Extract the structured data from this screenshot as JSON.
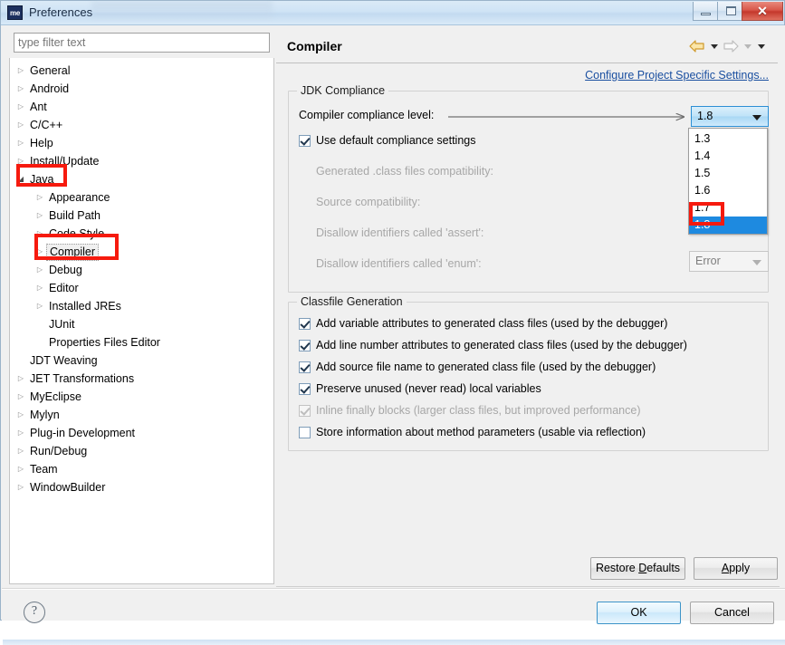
{
  "window": {
    "title": "Preferences",
    "app_icon_text": "me",
    "controls": {
      "minimize": "minimize-button",
      "maximize": "maximize-button",
      "close_glyph": "✕"
    }
  },
  "filter": {
    "value": "",
    "placeholder": "type filter text"
  },
  "tree": {
    "items": [
      {
        "label": "General",
        "indent": 0,
        "twisty": "collapsed",
        "selected": false
      },
      {
        "label": "Android",
        "indent": 0,
        "twisty": "collapsed",
        "selected": false
      },
      {
        "label": "Ant",
        "indent": 0,
        "twisty": "collapsed",
        "selected": false
      },
      {
        "label": "C/C++",
        "indent": 0,
        "twisty": "collapsed",
        "selected": false
      },
      {
        "label": "Help",
        "indent": 0,
        "twisty": "collapsed",
        "selected": false
      },
      {
        "label": "Install/Update",
        "indent": 0,
        "twisty": "collapsed",
        "selected": false
      },
      {
        "label": "Java",
        "indent": 0,
        "twisty": "expanded",
        "selected": false
      },
      {
        "label": "Appearance",
        "indent": 1,
        "twisty": "collapsed",
        "selected": false
      },
      {
        "label": "Build Path",
        "indent": 1,
        "twisty": "collapsed",
        "selected": false
      },
      {
        "label": "Code Style",
        "indent": 1,
        "twisty": "collapsed",
        "selected": false
      },
      {
        "label": "Compiler",
        "indent": 1,
        "twisty": "collapsed",
        "selected": true
      },
      {
        "label": "Debug",
        "indent": 1,
        "twisty": "collapsed",
        "selected": false
      },
      {
        "label": "Editor",
        "indent": 1,
        "twisty": "collapsed",
        "selected": false
      },
      {
        "label": "Installed JREs",
        "indent": 1,
        "twisty": "collapsed",
        "selected": false
      },
      {
        "label": "JUnit",
        "indent": 1,
        "twisty": "none",
        "selected": false
      },
      {
        "label": "Properties Files Editor",
        "indent": 1,
        "twisty": "none",
        "selected": false
      },
      {
        "label": "JDT Weaving",
        "indent": 0,
        "twisty": "none",
        "selected": false
      },
      {
        "label": "JET Transformations",
        "indent": 0,
        "twisty": "collapsed",
        "selected": false
      },
      {
        "label": "MyEclipse",
        "indent": 0,
        "twisty": "collapsed",
        "selected": false
      },
      {
        "label": "Mylyn",
        "indent": 0,
        "twisty": "collapsed",
        "selected": false
      },
      {
        "label": "Plug-in Development",
        "indent": 0,
        "twisty": "collapsed",
        "selected": false
      },
      {
        "label": "Run/Debug",
        "indent": 0,
        "twisty": "collapsed",
        "selected": false
      },
      {
        "label": "Team",
        "indent": 0,
        "twisty": "collapsed",
        "selected": false
      },
      {
        "label": "WindowBuilder",
        "indent": 0,
        "twisty": "collapsed",
        "selected": false
      }
    ]
  },
  "page": {
    "title": "Compiler",
    "configure_link": "Configure Project Specific Settings...",
    "nav": {
      "back_icon": "back-arrow-icon",
      "forward_icon": "forward-arrow-icon",
      "menu_icon": "view-menu-icon"
    }
  },
  "jdk_compliance": {
    "legend": "JDK Compliance",
    "compliance_level_label": "Compiler compliance level:",
    "compliance_level_value": "1.8",
    "use_default": {
      "label": "Use default compliance settings",
      "checked": true,
      "enabled": true
    },
    "rows": [
      {
        "label": "Generated .class files compatibility:",
        "enabled": false
      },
      {
        "label": "Source compatibility:",
        "enabled": false
      },
      {
        "label": "Disallow identifiers called 'assert':",
        "enabled": false
      },
      {
        "label": "Disallow identifiers called 'enum':",
        "enabled": false
      }
    ],
    "enum_combo_value": "Error",
    "dropdown": {
      "open": true,
      "options": [
        "1.3",
        "1.4",
        "1.5",
        "1.6",
        "1.7",
        "1.8"
      ],
      "selected": "1.8"
    }
  },
  "classfile_generation": {
    "legend": "Classfile Generation",
    "options": [
      {
        "label": "Add variable attributes to generated class files (used by the debugger)",
        "checked": true,
        "enabled": true
      },
      {
        "label": "Add line number attributes to generated class files (used by the debugger)",
        "checked": true,
        "enabled": true
      },
      {
        "label": "Add source file name to generated class file (used by the debugger)",
        "checked": true,
        "enabled": true
      },
      {
        "label": "Preserve unused (never read) local variables",
        "checked": true,
        "enabled": true
      },
      {
        "label": "Inline finally blocks (larger class files, but improved performance)",
        "checked": true,
        "enabled": false
      },
      {
        "label": "Store information about method parameters (usable via reflection)",
        "checked": false,
        "enabled": true
      }
    ]
  },
  "buttons": {
    "restore_defaults": "Restore Defaults",
    "apply": "Apply",
    "ok": "OK",
    "cancel": "Cancel",
    "help_glyph": "?"
  },
  "annotations": {
    "highlight_color": "#f61a0e",
    "boxes": [
      "java-tree-node",
      "compiler-tree-node",
      "dropdown-option-1.8"
    ],
    "pointer_arrow": "compliance-level-to-dropdown"
  },
  "colors": {
    "accent": "#1e8ae0",
    "link": "#1a4fa0",
    "selection": "#1e8ae0",
    "annotation": "#f61a0e",
    "titlebar": "#cfe3f5"
  }
}
